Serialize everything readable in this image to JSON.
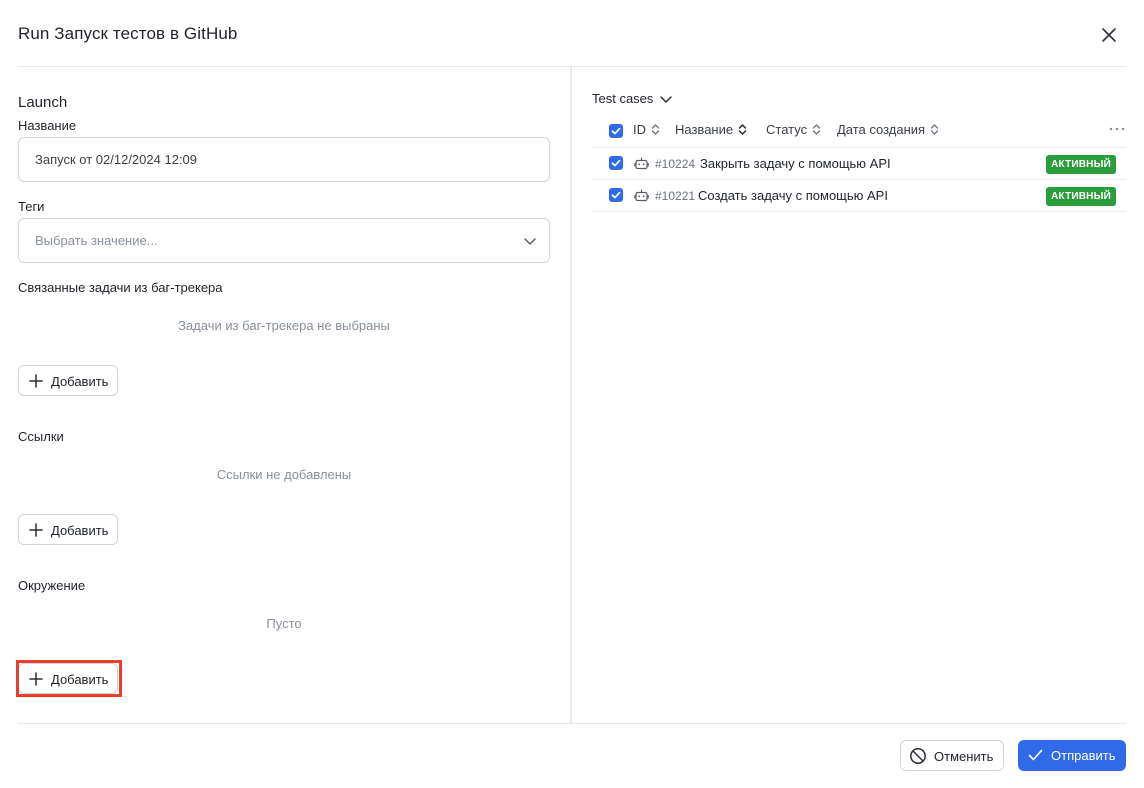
{
  "dialog": {
    "title": "Run Запуск тестов в GitHub"
  },
  "launch": {
    "section_title": "Launch",
    "name_label": "Название",
    "name_value": "Запуск от 02/12/2024 12:09",
    "tags_label": "Теги",
    "tags_placeholder": "Выбрать значение...",
    "issues_label": "Связанные задачи из баг-трекера",
    "issues_empty": "Задачи из баг-трекера не выбраны",
    "links_label": "Ссылки",
    "links_empty": "Ссылки не добавлены",
    "env_label": "Окружение",
    "env_empty": "Пусто",
    "add_label": "Добавить"
  },
  "test_cases": {
    "header": "Test cases",
    "columns": [
      "ID",
      "Название",
      "Статус",
      "Дата создания"
    ],
    "rows": [
      {
        "id": "#10224",
        "name": "Закрыть задачу с помощью API",
        "status": "АКТИВНЫЙ",
        "checked": true
      },
      {
        "id": "#10221",
        "name": "Создать задачу с помощью API",
        "status": "АКТИВНЫЙ",
        "checked": true
      }
    ]
  },
  "footer": {
    "cancel_label": "Отменить",
    "submit_label": "Отправить"
  },
  "colors": {
    "accent": "#2f6be8",
    "status_active": "#2a9d3a",
    "highlight": "#e8402a"
  }
}
